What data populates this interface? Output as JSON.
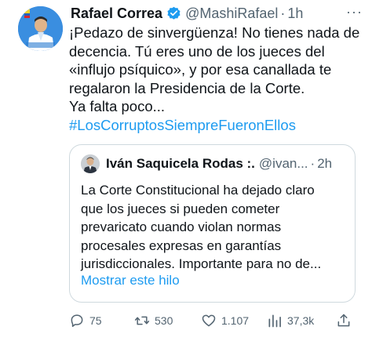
{
  "tweet": {
    "author_name": "Rafael Correa",
    "handle": "@MashiRafael",
    "separator": "·",
    "time": "1h",
    "more_label": "···",
    "lines": [
      "¡Pedazo de sinvergüenza! No tienes nada de",
      "decencia. Tú eres uno de los jueces del",
      "«influjo psíquico», y por esa canallada te",
      "regalaron la Presidencia de la Corte.",
      "Ya falta poco..."
    ],
    "hashtag": "#LosCorruptosSiempreFueronEllos"
  },
  "quoted": {
    "author_name": "Iván Saquicela Rodas :.",
    "handle": "@ivan...",
    "separator": "·",
    "time": "2h",
    "lines": [
      "La Corte Constitucional ha dejado claro",
      "que los jueces si pueden cometer",
      "prevaricato cuando violan normas",
      "procesales expresas en garantías",
      "jurisdiccionales. Importante para no de..."
    ],
    "show_thread": "Mostrar este hilo"
  },
  "actions": {
    "replies": "75",
    "retweets": "530",
    "likes": "1.107",
    "views": "37,3k"
  },
  "icons": [
    "verified-badge-icon",
    "reply-icon",
    "retweet-icon",
    "like-icon",
    "views-icon",
    "share-icon",
    "more-icon"
  ],
  "colors": {
    "link": "#1d9bf0",
    "secondary": "#536471",
    "border": "#cfd9de"
  }
}
